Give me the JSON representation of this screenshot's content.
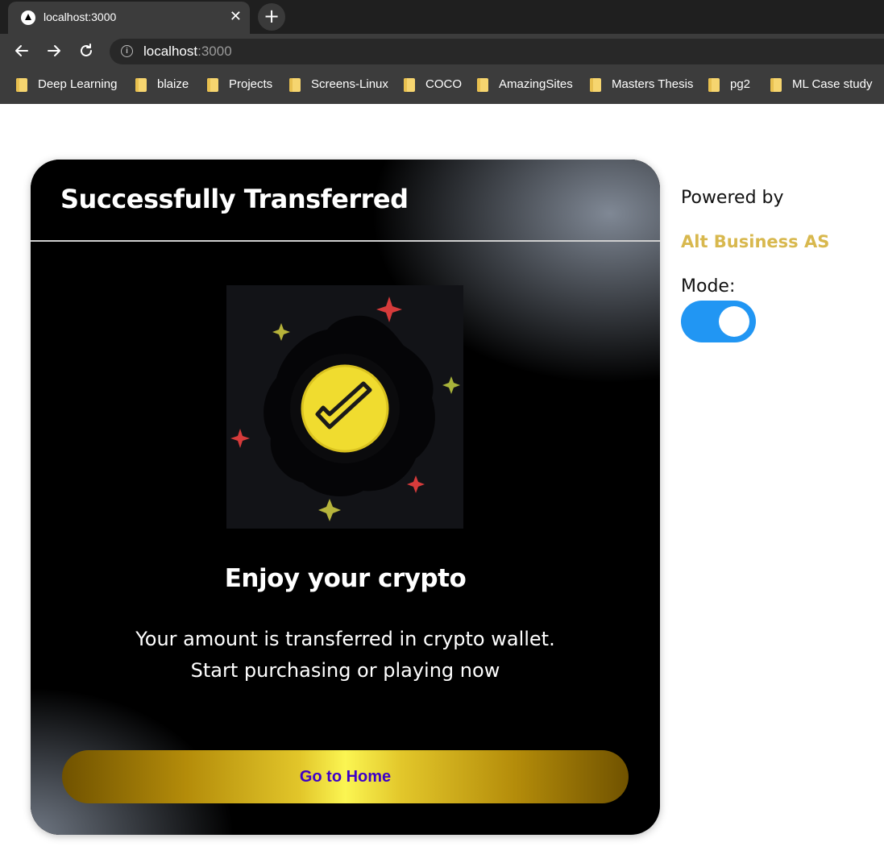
{
  "browser": {
    "tab_title": "localhost:3000",
    "tab_close": "✕",
    "new_tab": "+",
    "url_host": "localhost",
    "url_port": ":3000",
    "bookmarks": [
      "Deep Learning",
      "blaize",
      "Projects",
      "Screens-Linux",
      "COCO",
      "AmazingSites",
      "Masters Thesis",
      "pg2",
      "ML Case study"
    ]
  },
  "card": {
    "title": "Successfully Transferred",
    "heading": "Enjoy your crypto",
    "description_line1": "Your amount is transferred in crypto wallet.",
    "description_line2": "Start purchasing or playing now",
    "button_label": "Go to Home"
  },
  "sidebar": {
    "powered_by": "Powered by",
    "brand": "Alt Business AS",
    "mode_label": "Mode:",
    "mode_toggle_on": true
  },
  "colors": {
    "toggle": "#2196f3",
    "brand": "#d8b84e",
    "button_text": "#3d00c8",
    "gold_center": "#fbf552"
  },
  "icons": {
    "illustration": "success-checkmark-coin-icon",
    "back": "arrow-left-icon",
    "forward": "arrow-right-icon",
    "reload": "reload-icon",
    "info": "info-icon",
    "bookmark": "folder-icon"
  }
}
